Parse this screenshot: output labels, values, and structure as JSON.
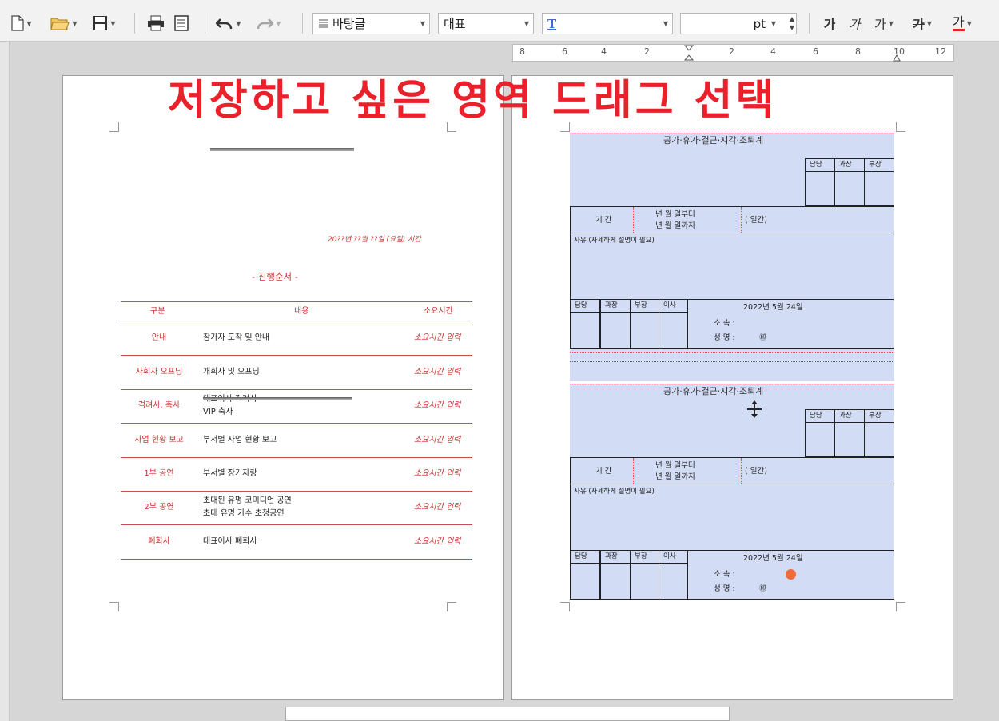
{
  "toolbar": {
    "style_name": "바탕글",
    "font_lang": "대표",
    "font_name": "",
    "font_size_unit": "pt",
    "format_buttons": [
      "가",
      "가",
      "가",
      "가",
      "가"
    ]
  },
  "ruler": {
    "labels": [
      "8",
      "6",
      "4",
      "2",
      "2",
      "4",
      "6",
      "8",
      "10",
      "12"
    ]
  },
  "overlay_caption": "저장하고 싶은 영역 드래그 선택",
  "left_page": {
    "date_line": "20??년 ??월 ??일 (요일) 시간",
    "program_title": "- 진행순서 -",
    "table_headers": [
      "구분",
      "내용",
      "소요시간"
    ],
    "rows": [
      {
        "category": "안내",
        "content": [
          "참가자 도착 및 안내"
        ],
        "time": "소요시간 입력"
      },
      {
        "category": "사회자 오프닝",
        "content": [
          "개회사 및 오프닝"
        ],
        "time": "소요시간 입력"
      },
      {
        "category": "격려사, 축사",
        "content": [
          "대표이사 격려사",
          "VIP 축사"
        ],
        "time": "소요시간 입력"
      },
      {
        "category": "사업 현황 보고",
        "content": [
          "부서별 사업 현황 보고"
        ],
        "time": "소요시간 입력"
      },
      {
        "category": "1부 공연",
        "content": [
          "부서별 장기자랑"
        ],
        "time": "소요시간 입력"
      },
      {
        "category": "2부 공연",
        "content": [
          "초대된 유명 코미디언 공연",
          "초대 유명 가수 초청공연"
        ],
        "time": "소요시간 입력"
      },
      {
        "category": "폐회사",
        "content": [
          "대표이사 폐회사"
        ],
        "time": "소요시간 입력"
      }
    ]
  },
  "form": {
    "title": "공가·휴가·결근·지각·조퇴계",
    "approval_cols": [
      "담당",
      "과장",
      "부장"
    ],
    "period_label": "기 간",
    "period_lines": [
      "년 월 일부터",
      "년 월 일까지"
    ],
    "days": "(    일간)",
    "reason_label": "사유 (자세하게 설명이 필요)",
    "bottom_cols": [
      "담당",
      "과장",
      "부장",
      "이사"
    ],
    "date_text": "2022년 5월 24일",
    "dept_label": "소 속 :",
    "name_label": "성 명 :",
    "seal": "㊞"
  },
  "colors": {
    "overlay": "#e8212b",
    "form_fill": "#d2dcf5",
    "table_red": "#c94b4b"
  }
}
